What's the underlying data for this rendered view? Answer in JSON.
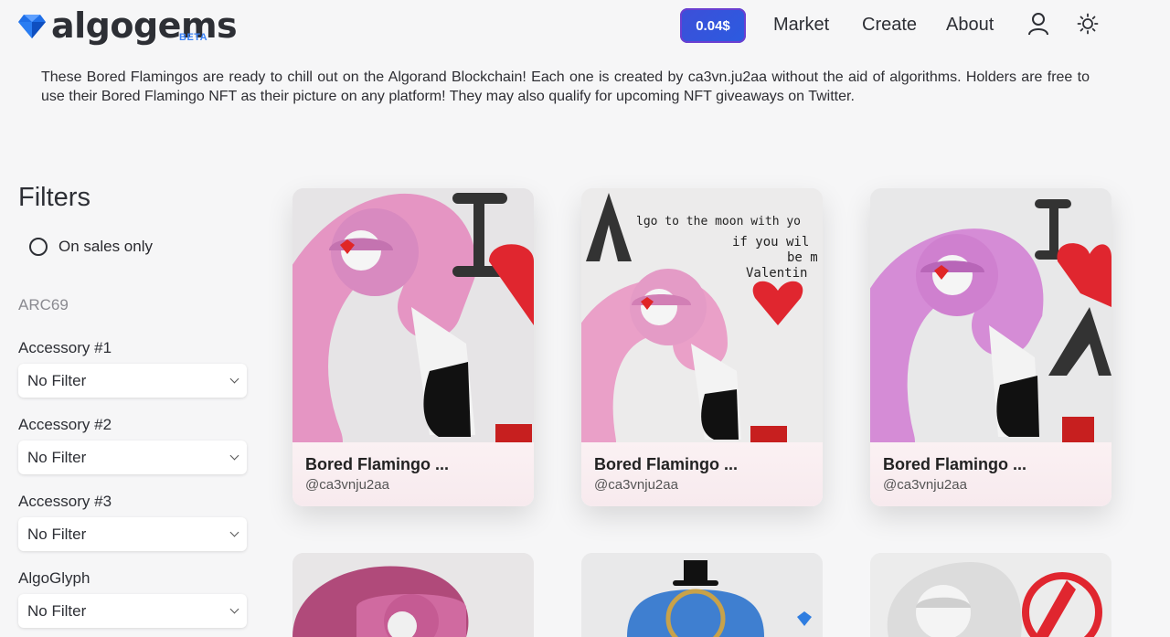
{
  "header": {
    "brand": "algogems",
    "badge": "BETA",
    "price": "0.04$",
    "nav": [
      "Market",
      "Create",
      "About"
    ]
  },
  "description": "These Bored Flamingos are ready to chill out on the Algorand Blockchain! Each one is created by ca3vn.ju2aa without the aid of algorithms. Holders are free to use their Bored Flamingo NFT as their picture on any platform! They may also qualify for upcoming NFT giveaways on Twitter.",
  "filters": {
    "title": "Filters",
    "on_sales_label": "On sales only",
    "section_label": "ARC69",
    "groups": [
      {
        "label": "Accessory #1",
        "value": "No Filter"
      },
      {
        "label": "Accessory #2",
        "value": "No Filter"
      },
      {
        "label": "Accessory #3",
        "value": "No Filter"
      },
      {
        "label": "AlgoGlyph",
        "value": "No Filter"
      }
    ]
  },
  "cards": [
    {
      "title": "Bored Flamingo ...",
      "author": "@ca3vnju2aa"
    },
    {
      "title": "Bored Flamingo ...",
      "author": "@ca3vnju2aa"
    },
    {
      "title": "Bored Flamingo ...",
      "author": "@ca3vnju2aa"
    }
  ],
  "card2_text": {
    "line1": "lgo to the moon with yo",
    "line2": "if you wil",
    "line3": "be m",
    "line4": "Valentin"
  },
  "colors": {
    "accent": "#3b82f6",
    "price_bg": "#3d4fd8",
    "flamingo_pink": "#e58fbf"
  }
}
